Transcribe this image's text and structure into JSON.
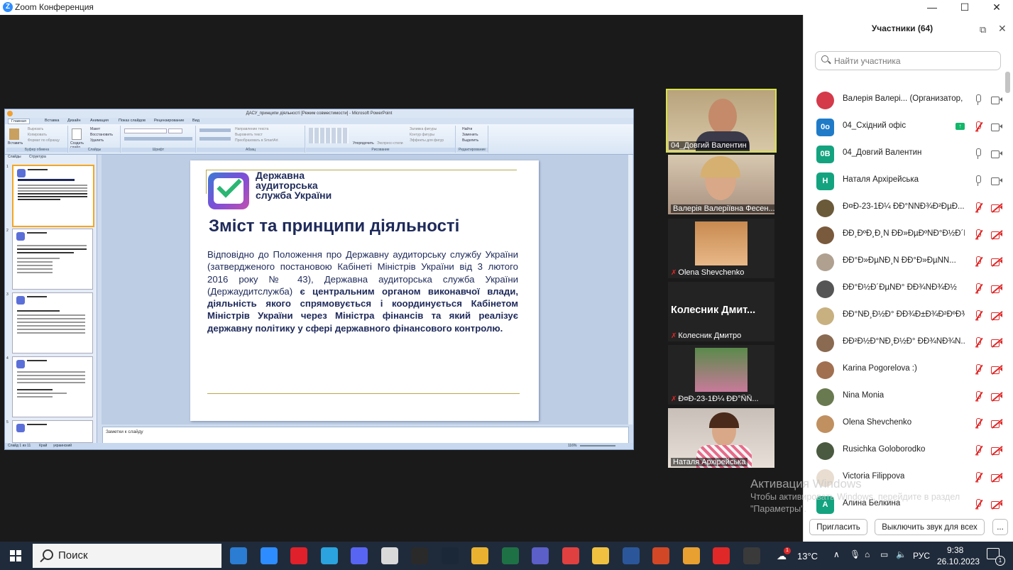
{
  "window": {
    "title": "Zoom Конференция",
    "min": "—",
    "max": "☐",
    "close": "✕"
  },
  "ppt": {
    "title": "ДАСУ_принципи діяльності [Режим совместимости] - Microsoft PowerPoint",
    "tabs": [
      "Главная",
      "Вставка",
      "Дизайн",
      "Анимация",
      "Показ слайдов",
      "Рецензирование",
      "Вид"
    ],
    "groups": [
      "Буфер обмена",
      "Слайды",
      "Шрифт",
      "Абзац",
      "Рисование",
      "Редактирование"
    ],
    "clip_items": [
      "Вставить",
      "Вырезать",
      "Копировать",
      "Формат по образцу"
    ],
    "slide_items": [
      "Создать слайд",
      "Макет",
      "Восстановить",
      "Удалить"
    ],
    "para_items": [
      "Направление текста",
      "Выровнять текст",
      "Преобразовать в SmartArt"
    ],
    "draw_items": [
      "Упорядочить",
      "Экспресс-стили",
      "Заливка фигуры",
      "Контур фигуры",
      "Эффекты для фигур"
    ],
    "edit_items": [
      "Найти",
      "Заменить",
      "Выделить"
    ],
    "pane_tabs": [
      "Слайды",
      "Структура"
    ],
    "thumb_nums": [
      "1",
      "2",
      "3",
      "4",
      "5"
    ],
    "notes": "Заметки к слайду",
    "status_slide": "Слайд 1 из 11",
    "status_theme": "Край",
    "status_lang": "украинский",
    "zoom": "116%"
  },
  "slide": {
    "org": "Державна аудиторська служба України",
    "title": "Зміст та принципи діяльності",
    "body_normal": "Відповідно до Положення про Державну аудиторську службу України (затвердженого постановою Кабінеті Міністрів України від 3 лютого 2016 року № 43), Державна аудиторська служба України (Держаудитслужба) ",
    "body_bold": "є центральним органом виконавчої влади, діяльність якого спрямовується і координується Кабінетом Міністрів України через Міністра фінансів та який реалізує державну політику у сфері державного фінансового контролю."
  },
  "videos": [
    {
      "name": "04_Довгий Валентин",
      "muted": false
    },
    {
      "name": "Валерія Валеріївна Фесен...",
      "muted": false
    },
    {
      "name": "Olena Shevchenko",
      "muted": true
    },
    {
      "name": "Колесник Дмитро",
      "muted": true,
      "big_label": "Колесник Дмит..."
    },
    {
      "name": "Ð¤Ð-23-1Ð¼ ÐÐ°ÑÑ...",
      "muted": true
    },
    {
      "name": "Наталя Архірейська",
      "muted": false
    }
  ],
  "panel": {
    "title": "Участники (64)",
    "search_placeholder": "Найти участника",
    "participants": [
      {
        "name": "Валерія Валері... (Организатор, я)",
        "avatar": "",
        "color": "#d43a4a",
        "mic": "on",
        "cam": "on"
      },
      {
        "name": "04_Східний офіс",
        "avatar": "0о",
        "color": "#1f7bc8",
        "mic": "off",
        "cam": "on",
        "sharing": true
      },
      {
        "name": "04_Довгий Валентин",
        "avatar": "0В",
        "color": "#14a37f",
        "mic": "on",
        "cam": "on"
      },
      {
        "name": "Наталя Архірейська",
        "avatar": "Н",
        "color": "#14a37f",
        "mic": "on",
        "cam": "on"
      },
      {
        "name": "Ð¤Ð-23-1Ð¼ ÐÐ°ÑÑÐ¾Ð²ÐµÐ...",
        "avatar": "",
        "color": "#6b5a3a",
        "mic": "off",
        "cam": "off"
      },
      {
        "name": "ÐÐ¸ÐºÐ¸Ð¸Ñ ÐÐ»ÐµÐºÑÐ°Ð½Ð´ÑÐ¾Ð²Ð¸Ñ...",
        "avatar": "",
        "color": "#7a5a3c",
        "mic": "off",
        "cam": "off"
      },
      {
        "name": "ÐÐ°Ð»ÐµÑÐ¸Ñ ÐÐ°Ð»ÐµÑÑ...",
        "avatar": "",
        "color": "#b0a090",
        "mic": "off",
        "cam": "off"
      },
      {
        "name": "ÐÐ°Ð½Ð´ÐµÑÐ° ÐÐ¾ÑÐ¾Ð½",
        "avatar": "",
        "color": "#555555",
        "mic": "off",
        "cam": "off"
      },
      {
        "name": "ÐÐ°ÑÐ¸Ð½Ð° ÐÐ¾Ð±Ð¾Ð²ÐºÐ¾ÐµÐ²Ð°...",
        "avatar": "",
        "color": "#c8b080",
        "mic": "off",
        "cam": "off"
      },
      {
        "name": "ÐÐ²Ð½Ð°ÑÐ¸Ð½Ð° ÐÐ¾ÑÐ¾Ñ...",
        "avatar": "",
        "color": "#8a6a50",
        "mic": "off",
        "cam": "off"
      },
      {
        "name": "Karina Pogorelova :)",
        "avatar": "",
        "color": "#a07050",
        "mic": "off",
        "cam": "off"
      },
      {
        "name": "Nina Monia",
        "avatar": "",
        "color": "#6a7a50",
        "mic": "off",
        "cam": "off"
      },
      {
        "name": "Olena Shevchenko",
        "avatar": "",
        "color": "#c09060",
        "mic": "off",
        "cam": "off"
      },
      {
        "name": "Rusichka Goloborodko",
        "avatar": "",
        "color": "#4a5a40",
        "mic": "off",
        "cam": "off"
      },
      {
        "name": "Victoria Filippova",
        "avatar": "",
        "color": "#e8ddd0",
        "mic": "off",
        "cam": "off"
      },
      {
        "name": "Алина Белкина",
        "avatar": "А",
        "color": "#14a37f",
        "mic": "off",
        "cam": "off"
      }
    ],
    "invite": "Пригласить",
    "mute_all": "Выключить звук для всех",
    "more": "..."
  },
  "watermark": {
    "line1": "Активация Windows",
    "line2": "Чтобы активировать Windows, перейдите в раздел",
    "line3": "\"Параметры\"."
  },
  "taskbar": {
    "search": "Поиск",
    "temp": "13°C",
    "lang": "РУС",
    "time": "9:38",
    "date": "26.10.2023",
    "notif": "1",
    "weather_badge": "1",
    "apps": [
      {
        "name": "mail",
        "color": "#2b7cd3"
      },
      {
        "name": "zoom",
        "color": "#2d8cff"
      },
      {
        "name": "opera",
        "color": "#e0202a"
      },
      {
        "name": "telegram",
        "color": "#2aa3df"
      },
      {
        "name": "discord",
        "color": "#5865f2"
      },
      {
        "name": "roblox",
        "color": "#d9d9d9"
      },
      {
        "name": "epic-games",
        "color": "#2a2a2a"
      },
      {
        "name": "steam",
        "color": "#1b2838"
      },
      {
        "name": "chrome",
        "color": "#e8b230"
      },
      {
        "name": "excel",
        "color": "#1e7145"
      },
      {
        "name": "teams",
        "color": "#5b5fc7"
      },
      {
        "name": "chrome-profile",
        "color": "#e04040"
      },
      {
        "name": "explorer",
        "color": "#f0c040"
      },
      {
        "name": "word",
        "color": "#2b579a"
      },
      {
        "name": "powerpoint",
        "color": "#d24726"
      },
      {
        "name": "chrome-alt",
        "color": "#e8a030"
      },
      {
        "name": "acrobat",
        "color": "#e02828"
      },
      {
        "name": "snipping",
        "color": "#3a3a3a"
      }
    ]
  }
}
